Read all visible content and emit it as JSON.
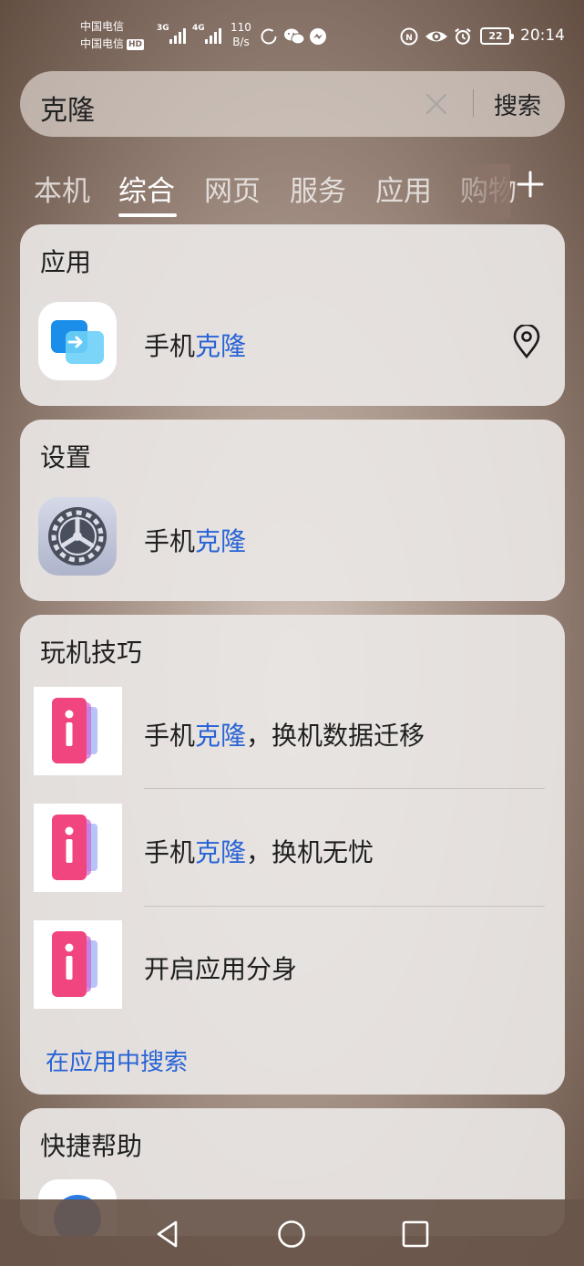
{
  "status_bar": {
    "carrier_1": "中国电信",
    "carrier_2": "中国电信",
    "hd_badge": "HD",
    "signal_1_type": "3G",
    "signal_2_type": "4G",
    "speed_value": "110",
    "speed_unit": "B/s",
    "battery_level": "22",
    "time": "20:14",
    "icons": [
      "loading-circle-icon",
      "wechat-icon",
      "messenger-icon",
      "nfc-icon",
      "eye-comfort-icon",
      "alarm-icon",
      "battery-icon"
    ]
  },
  "search": {
    "query": "克隆",
    "button_label": "搜索"
  },
  "tabs": [
    {
      "label": "本机",
      "active": false
    },
    {
      "label": "综合",
      "active": true
    },
    {
      "label": "网页",
      "active": false
    },
    {
      "label": "服务",
      "active": false
    },
    {
      "label": "应用",
      "active": false
    },
    {
      "label": "购物",
      "active": false
    }
  ],
  "cards": {
    "apps": {
      "title": "应用",
      "item": {
        "prefix": "手机",
        "highlight": "克隆",
        "suffix": ""
      }
    },
    "settings": {
      "title": "设置",
      "item": {
        "prefix": "手机",
        "highlight": "克隆",
        "suffix": ""
      }
    },
    "tips": {
      "title": "玩机技巧",
      "items": [
        {
          "prefix": "手机",
          "highlight": "克隆",
          "suffix": "，换机数据迁移"
        },
        {
          "prefix": "手机",
          "highlight": "克隆",
          "suffix": "，换机无忧"
        },
        {
          "prefix": "开启应用分身",
          "highlight": "",
          "suffix": ""
        }
      ],
      "link": "在应用中搜索"
    },
    "quick_help": {
      "title": "快捷帮助"
    }
  },
  "colors": {
    "highlight": "#2863d6",
    "card_bg": "#eae6e4",
    "tip_icon_pink": "#f0457f"
  }
}
